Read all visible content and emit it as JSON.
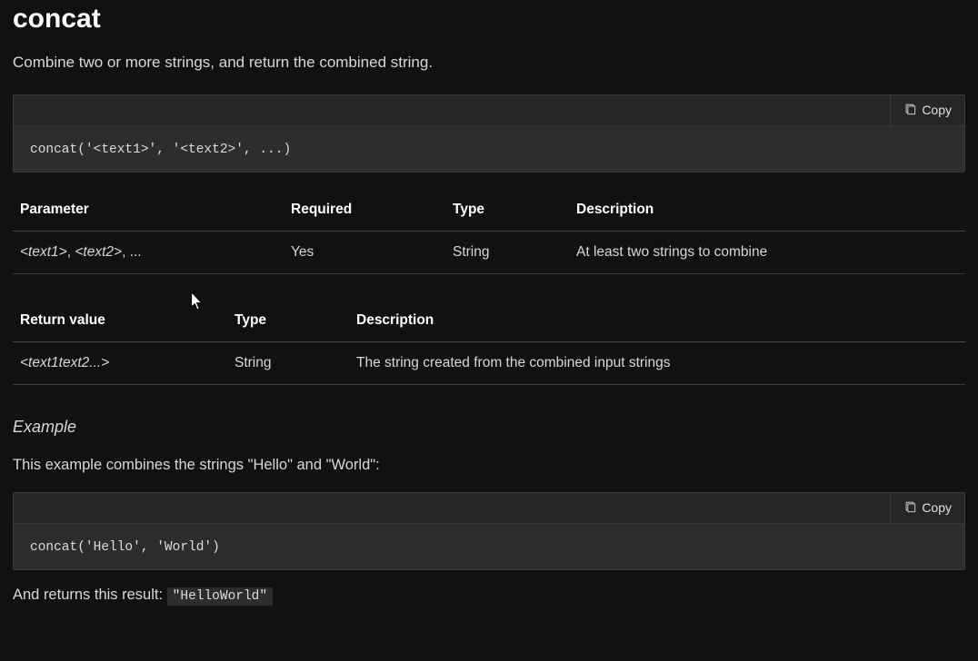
{
  "title": "concat",
  "description": "Combine two or more strings, and return the combined string.",
  "code_block_1": {
    "copy_label": "Copy",
    "code": "concat('<text1>', '<text2>', ...)"
  },
  "param_table": {
    "headers": {
      "parameter": "Parameter",
      "required": "Required",
      "type": "Type",
      "description": "Description"
    },
    "row": {
      "param_prefix1": "<text1>",
      "param_sep": ", ",
      "param_prefix2": "<text2>",
      "param_suffix": ", ...",
      "required": "Yes",
      "type": "String",
      "description": "At least two strings to combine"
    }
  },
  "return_table": {
    "headers": {
      "return_value": "Return value",
      "type": "Type",
      "description": "Description"
    },
    "row": {
      "value": "<text1text2...>",
      "type": "String",
      "description": "The string created from the combined input strings"
    }
  },
  "example": {
    "heading": "Example",
    "intro": "This example combines the strings \"Hello\" and \"World\":",
    "code_block": {
      "copy_label": "Copy",
      "code": "concat('Hello', 'World')"
    },
    "result_prefix": "And returns this result: ",
    "result_code": "\"HelloWorld\""
  }
}
